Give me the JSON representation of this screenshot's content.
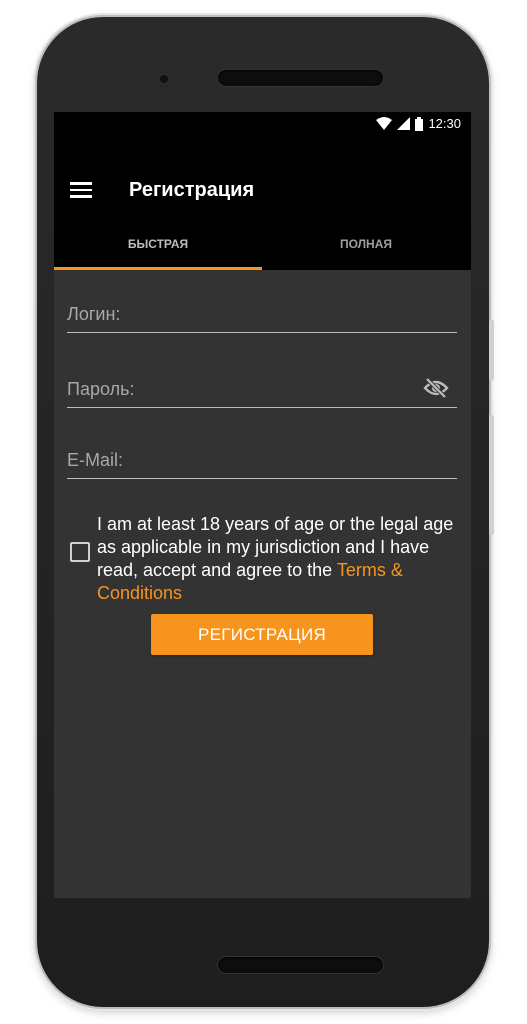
{
  "status_bar": {
    "time": "12:30"
  },
  "app_bar": {
    "title": "Регистрация"
  },
  "tabs": [
    {
      "label": "БЫСТРАЯ",
      "active": true
    },
    {
      "label": "ПОЛНАЯ",
      "active": false
    }
  ],
  "form": {
    "login_placeholder": "Логин:",
    "password_placeholder": "Пароль:",
    "email_placeholder": "E-Mail:",
    "consent_text": "I am at least 18 years of age or the legal age as applicable in my jurisdiction and I have read, accept and agree to the ",
    "terms_link": "Terms & Conditions",
    "consent_checked": false,
    "submit_label": "РЕГИСТРАЦИЯ"
  },
  "colors": {
    "accent": "#f7941d",
    "screen_background": "#333333",
    "app_bar": "#000000"
  },
  "icons": {
    "menu": "hamburger-menu-icon",
    "password_visibility": "eye-off-icon",
    "wifi": "wifi-icon",
    "signal": "signal-icon",
    "battery": "battery-icon"
  }
}
